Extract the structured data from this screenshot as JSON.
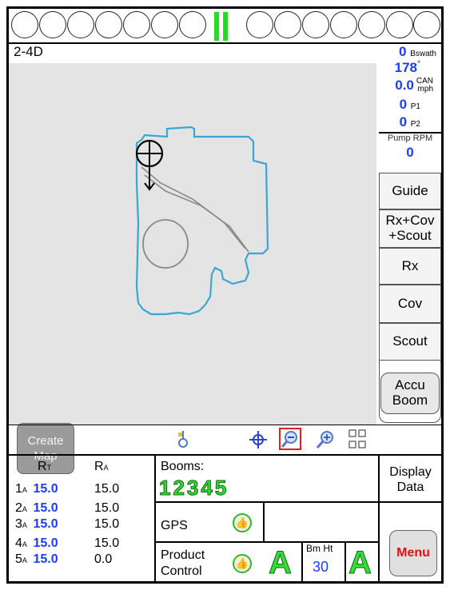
{
  "header": {
    "product_label": "2-4D",
    "section_count_left": 7,
    "section_count_right": 6
  },
  "info_panel": {
    "swath_value": "0",
    "swath_unit": "Bswath",
    "heading_value": "178",
    "heading_unit": "°",
    "speed_value": "0.0",
    "speed_unit_top": "CAN",
    "speed_unit_bottom": "mph",
    "p1_value": "0",
    "p1_unit": "P1",
    "p2_value": "0",
    "p2_unit": "P2",
    "pump_rpm_label": "Pump RPM",
    "pump_rpm_value": "0"
  },
  "right_buttons": {
    "guide": "Guide",
    "rx_cov_scout_line1": "Rx+Cov",
    "rx_cov_scout_line2": "+Scout",
    "rx": "Rx",
    "cov": "Cov",
    "scout": "Scout",
    "accu_boom_line1": "Accu",
    "accu_boom_line2": "Boom"
  },
  "map": {
    "create_map_line1": "Create",
    "create_map_line2": "Map"
  },
  "rates": {
    "head_target": "R",
    "head_target_sub": "T",
    "head_actual": "R",
    "head_actual_sub": "A",
    "rows": [
      {
        "idx": "1",
        "sub": "A",
        "target": "15.0",
        "actual": "15.0"
      },
      {
        "idx": "2",
        "sub": "A",
        "target": "15.0",
        "actual": "15.0"
      },
      {
        "idx": "3",
        "sub": "A",
        "target": "15.0",
        "actual": "15.0"
      },
      {
        "idx": "4",
        "sub": "A",
        "target": "15.0",
        "actual": "15.0"
      },
      {
        "idx": "5",
        "sub": "A",
        "target": "15.0",
        "actual": "0.0"
      }
    ]
  },
  "booms": {
    "label": "Booms:",
    "numbers": "12345"
  },
  "status": {
    "gps_label": "GPS",
    "product_control_line1": "Product",
    "product_control_line2": "Control",
    "auto_a1": "A",
    "bm_ht_label": "Bm Ht",
    "bm_ht_value": "30",
    "auto_a2": "A"
  },
  "display_data": {
    "line1": "Display",
    "line2": "Data"
  },
  "menu_label": "Menu",
  "colors": {
    "accent_blue": "#1a3cff",
    "boundary": "#3aa6d6",
    "section_active": "#22dd22",
    "menu_red": "#e01010"
  }
}
